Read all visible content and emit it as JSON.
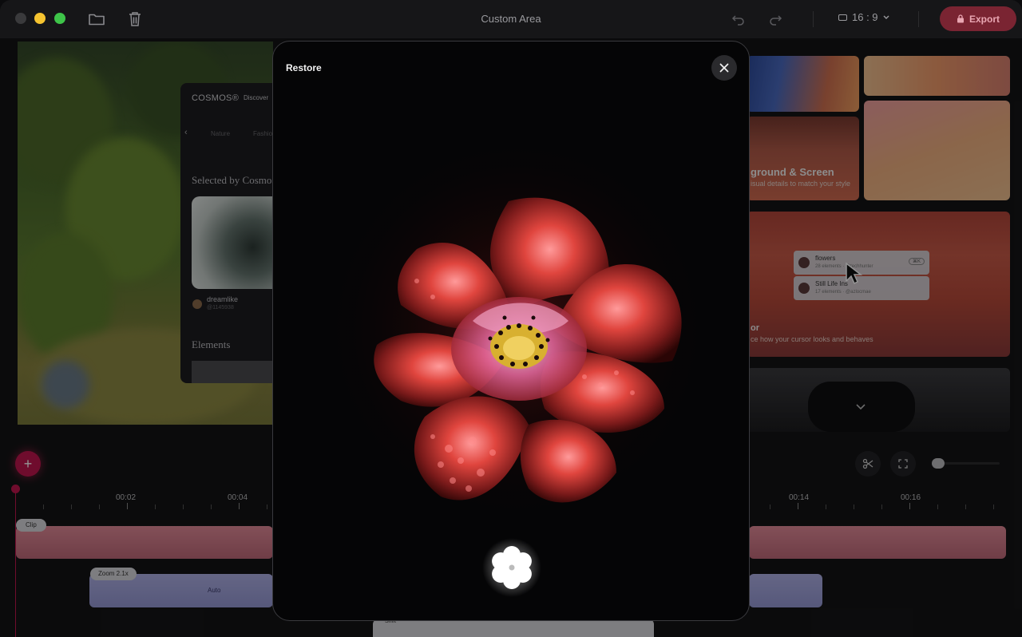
{
  "window": {
    "title": "Custom Area",
    "aspect_ratio": "16 : 9",
    "export_label": "Export",
    "accent_color": "#c0164e"
  },
  "canvas_left": {
    "brand": "COSMOS®",
    "nav_discover": "Discover",
    "tab_1": "Nature",
    "tab_2": "Fashion",
    "selected_heading": "Selected by Cosmos",
    "card_user": "dreamlike",
    "card_handle": "@1145938",
    "elements_heading": "Elements"
  },
  "right_tiles": {
    "background_title": "ground & Screen",
    "background_subtitle": "isual details to match your style",
    "cursor_title": "or",
    "cursor_subtitle": "ce how your cursor looks and behaves",
    "popup_items": [
      {
        "title": "flowers",
        "sub": "28 elements · @techhunter",
        "key": "⌘K"
      },
      {
        "title": "Still Life Ins",
        "sub": "17 elements · @azlocmae",
        "key": ""
      }
    ]
  },
  "timeline": {
    "time_labels": [
      "00:02",
      "00:04",
      "00:14",
      "00:16"
    ],
    "clip_label": "Clip",
    "zoom_label": "Zoom 2.1x",
    "zoom_mode": "Auto",
    "bottom_label": "Shift"
  },
  "modal": {
    "title": "Restore"
  },
  "icons": {
    "folder": "folder-icon",
    "trash": "trash-icon",
    "undo": "undo-icon",
    "redo": "redo-icon",
    "aspect": "aspect-ratio-icon",
    "lock": "lock-icon",
    "close": "close-icon",
    "scissors": "scissors-icon",
    "fullscreen": "fullscreen-icon",
    "chevron": "chevron-down-icon",
    "restore": "flower-icon"
  }
}
